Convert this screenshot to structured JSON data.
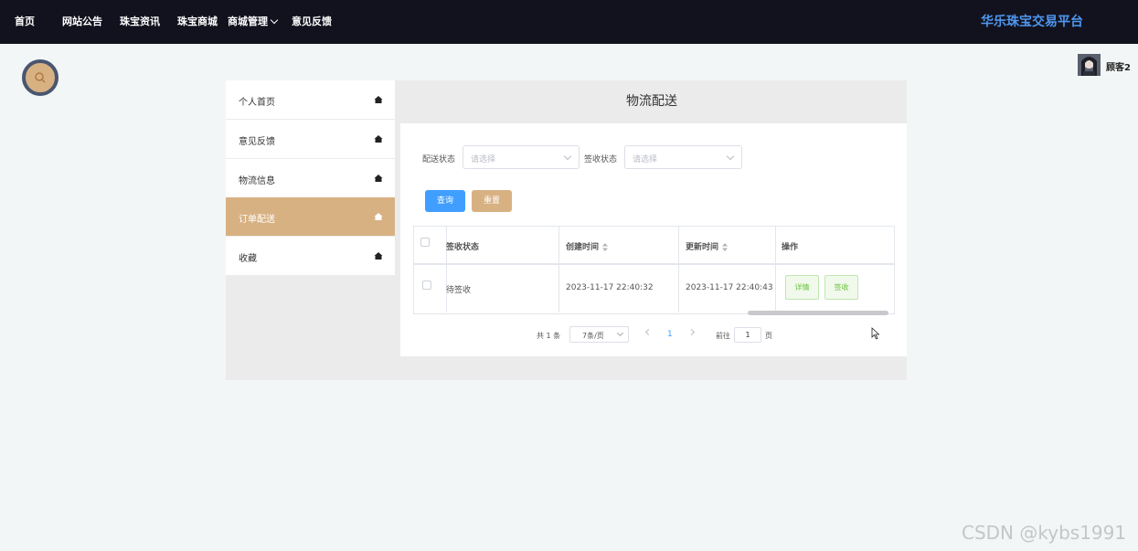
{
  "nav": {
    "items": [
      "首页",
      "网站公告",
      "珠宝资讯",
      "珠宝商城",
      "商城管理",
      "意见反馈"
    ],
    "site_title": "华乐珠宝交易平台"
  },
  "user": {
    "name": "顾客2"
  },
  "sidebar": {
    "items": [
      {
        "label": "个人首页",
        "icon": "home-icon"
      },
      {
        "label": "意见反馈",
        "icon": "home-icon"
      },
      {
        "label": "物流信息",
        "icon": "home-icon"
      },
      {
        "label": "订单配送",
        "icon": "home-icon",
        "active": true
      },
      {
        "label": "收藏",
        "icon": "home-icon"
      }
    ]
  },
  "page": {
    "title": "物流配送"
  },
  "filters": {
    "delivery_status_label": "配送状态",
    "delivery_status_placeholder": "请选择",
    "sign_status_label": "签收状态",
    "sign_status_placeholder": "请选择",
    "query_button": "查询",
    "reset_button": "重置"
  },
  "table": {
    "headers": [
      "签收状态",
      "创建时间",
      "更新时间",
      "操作"
    ],
    "rows": [
      {
        "sign_status": "待签收",
        "created": "2023-11-17 22:40:32",
        "updated": "2023-11-17 22:40:43",
        "actions": [
          "详情",
          "签收"
        ]
      }
    ]
  },
  "pagination": {
    "total": "共 1 条",
    "page_size": "7条/页",
    "current": "1",
    "goto_label": "前往",
    "goto_value": "1",
    "page_unit": "页"
  },
  "watermark": "CSDN @kybs1991",
  "colors": {
    "nav_bg": "#12121f",
    "accent": "#d8b183",
    "primary": "#409eff",
    "success": "#67c23a",
    "title_blue": "#4e97ef"
  }
}
